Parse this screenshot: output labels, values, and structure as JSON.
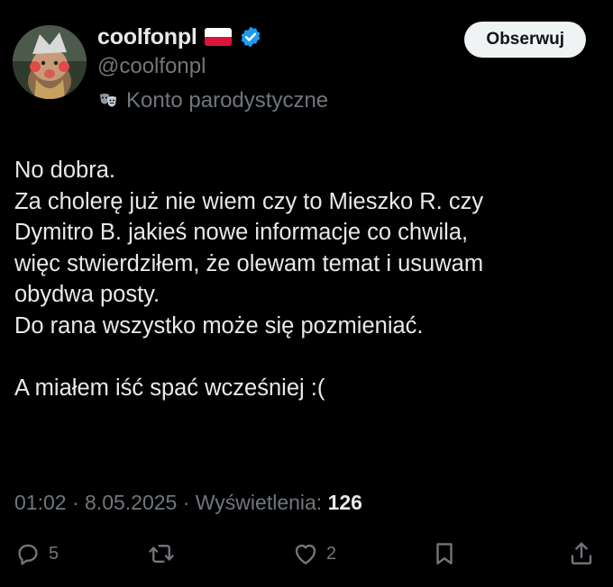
{
  "author": {
    "display_name": "coolfonpl",
    "handle": "@coolfonpl",
    "flag_icon": "poland-flag-icon",
    "verified_icon": "verified-badge-icon",
    "verified_color": "#1d9bf0",
    "parody_icon": "theater-masks-icon",
    "parody_label": "Konto parodystyczne"
  },
  "follow_button_label": "Obserwuj",
  "tweet": {
    "lines": [
      "No dobra.",
      "Za cholerę już nie wiem czy to Mieszko R. czy",
      "Dymitro B. jakieś nowe informacje co chwila,",
      "więc stwierdziłem, że olewam temat i usuwam",
      "obydwa posty.",
      "Do rana wszystko może się pozmieniać.",
      "",
      "A miałem iść spać wcześniej :("
    ]
  },
  "meta": {
    "time": "01:02",
    "separator": " · ",
    "date": "8.05.2025",
    "views_label": "Wyświetlenia: ",
    "views_count": "126"
  },
  "actions": {
    "reply_icon": "reply-bubble-icon",
    "reply_count": "5",
    "repost_icon": "repost-icon",
    "like_icon": "heart-icon",
    "like_count": "2",
    "bookmark_icon": "bookmark-icon",
    "share_icon": "share-icon"
  },
  "colors": {
    "background": "#000000",
    "text_primary": "#e7e9ea",
    "text_secondary": "#71767b",
    "button_bg": "#eff3f4",
    "button_text": "#0f1419"
  }
}
